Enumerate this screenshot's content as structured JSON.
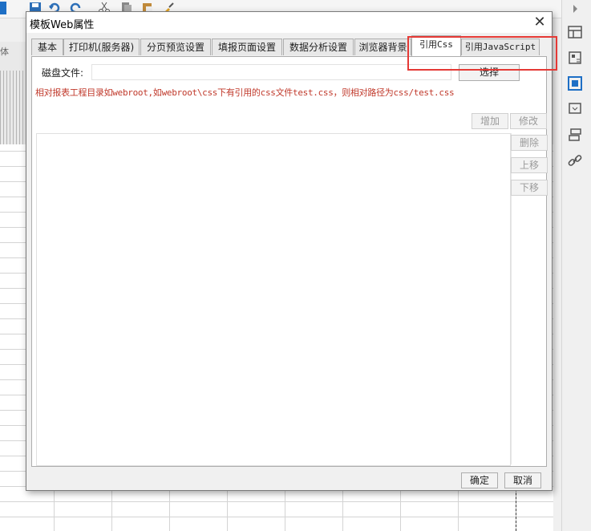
{
  "dialog": {
    "title": "模板Web属性",
    "close_label": "✕",
    "tabs": [
      {
        "label": "基本"
      },
      {
        "label": "打印机(服务器)"
      },
      {
        "label": "分页预览设置"
      },
      {
        "label": "填报页面设置"
      },
      {
        "label": "数据分析设置"
      },
      {
        "label": "浏览器背景"
      },
      {
        "label": "引用Css"
      },
      {
        "label": "引用JavaScript"
      }
    ],
    "active_tab": "引用Css",
    "disk_file_label": "磁盘文件:",
    "disk_file_value": "",
    "select_label": "选择",
    "hint": "相对报表工程目录如webroot,如webroot\\css下有引用的css文件test.css，则相对路径为css/test.css",
    "buttons": {
      "add": "增加",
      "modify": "修改",
      "delete": "删除",
      "move_up": "上移",
      "move_down": "下移"
    },
    "ok_label": "确定",
    "cancel_label": "取消"
  },
  "background": {
    "left_label": "体",
    "accent": "#1e6fc5"
  },
  "highlight_color": "#e53935"
}
